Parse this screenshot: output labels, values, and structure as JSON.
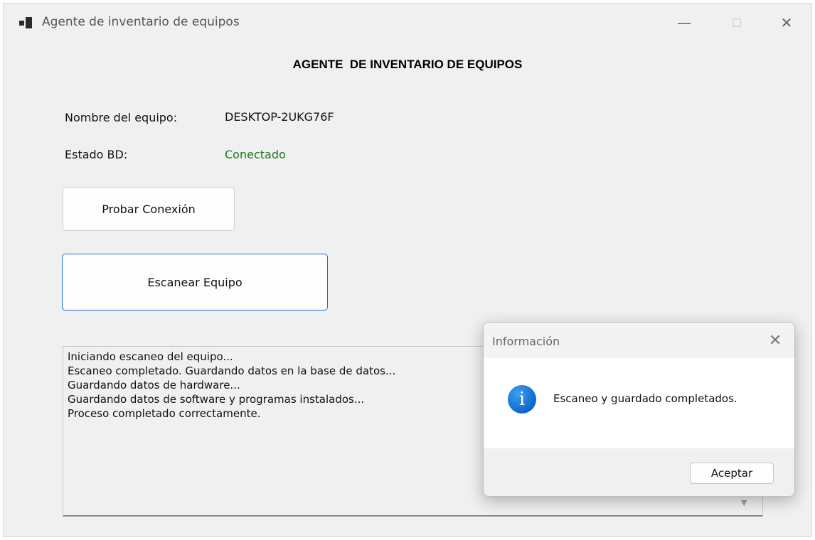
{
  "window": {
    "title": "Agente de inventario de equipos",
    "controls": {
      "minimize": "—",
      "maximize": "☐",
      "close": "✕"
    }
  },
  "main": {
    "heading": "AGENTE  DE INVENTARIO DE EQUIPOS",
    "computer_name_label": "Nombre del equipo:",
    "computer_name_value": "DESKTOP-2UKG76F",
    "db_status_label": "Estado BD:",
    "db_status_value": "Conectado",
    "db_status_color": "#1a7a1a",
    "test_connection_button": "Probar Conexión",
    "scan_button": "Escanear Equipo"
  },
  "log": {
    "lines": [
      "Iniciando escaneo del equipo...",
      "Escaneo completado. Guardando datos en la base de datos...",
      "Guardando datos de hardware...",
      "Guardando datos de software y programas instalados...",
      "Proceso completado correctamente."
    ]
  },
  "dialog": {
    "title": "Información",
    "close": "✕",
    "icon": "info-icon",
    "icon_glyph": "i",
    "message": "Escaneo y guardado completados.",
    "ok_button": "Aceptar"
  }
}
